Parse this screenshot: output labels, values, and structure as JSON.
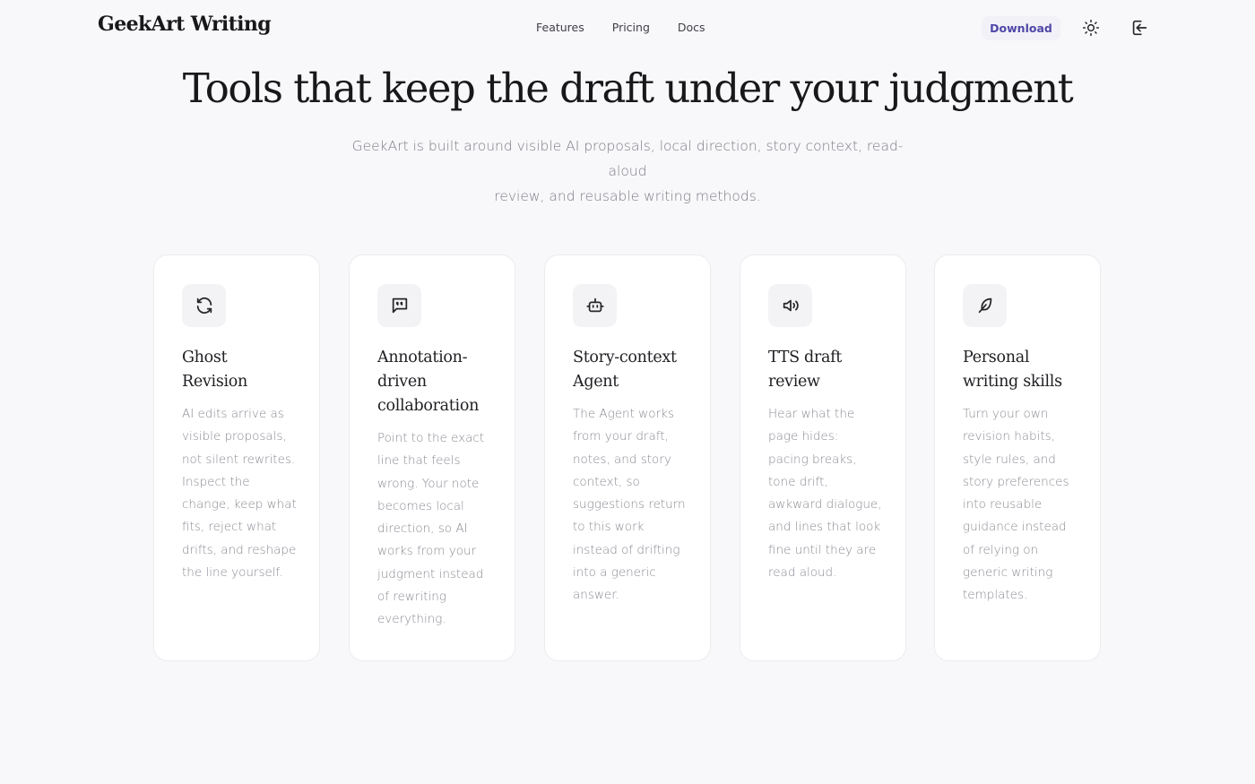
{
  "header": {
    "logo": "GeekArt Writing",
    "nav": [
      "Features",
      "Pricing",
      "Docs"
    ],
    "download_label": "Download"
  },
  "hero": {
    "title": "Tools that keep the draft under your judgment",
    "subtitle_line1": "GeekArt is built around visible AI proposals, local direction, story context, read-aloud",
    "subtitle_line2": "review, and reusable writing methods."
  },
  "features": [
    {
      "icon": "refresh-icon",
      "title_lines": [
        "Ghost",
        "Revision"
      ],
      "body_lines": [
        "AI edits arrive as",
        "visible proposals,",
        "not silent rewrites.",
        "Inspect the",
        "change, keep what",
        "fits, reject what",
        "drifts, and reshape",
        "the line yourself."
      ]
    },
    {
      "icon": "message-quote-icon",
      "title_lines": [
        "Annotation-",
        "driven",
        "collaboration"
      ],
      "body_lines": [
        "Point to the exact",
        "line that feels",
        "wrong. Your note",
        "becomes local",
        "direction, so AI",
        "works from your",
        "judgment instead",
        "of rewriting",
        "everything."
      ]
    },
    {
      "icon": "robot-icon",
      "title_lines": [
        "Story-context",
        "Agent"
      ],
      "body_lines": [
        "The Agent works",
        "from your draft,",
        "notes, and story",
        "context, so",
        "suggestions return",
        "to this work",
        "instead of drifting",
        "into a generic",
        "answer."
      ]
    },
    {
      "icon": "speaker-icon",
      "title_lines": [
        "TTS draft",
        "review"
      ],
      "body_lines": [
        "Hear what the",
        "page hides:",
        "pacing breaks,",
        "tone drift,",
        "awkward dialogue,",
        "and lines that look",
        "fine until they are",
        "read aloud."
      ]
    },
    {
      "icon": "feather-icon",
      "title_lines": [
        "Personal",
        "writing skills"
      ],
      "body_lines": [
        "Turn your own",
        "revision habits,",
        "style rules, and",
        "story preferences",
        "into reusable",
        "guidance instead",
        "of relying on",
        "generic writing",
        "templates."
      ]
    }
  ]
}
